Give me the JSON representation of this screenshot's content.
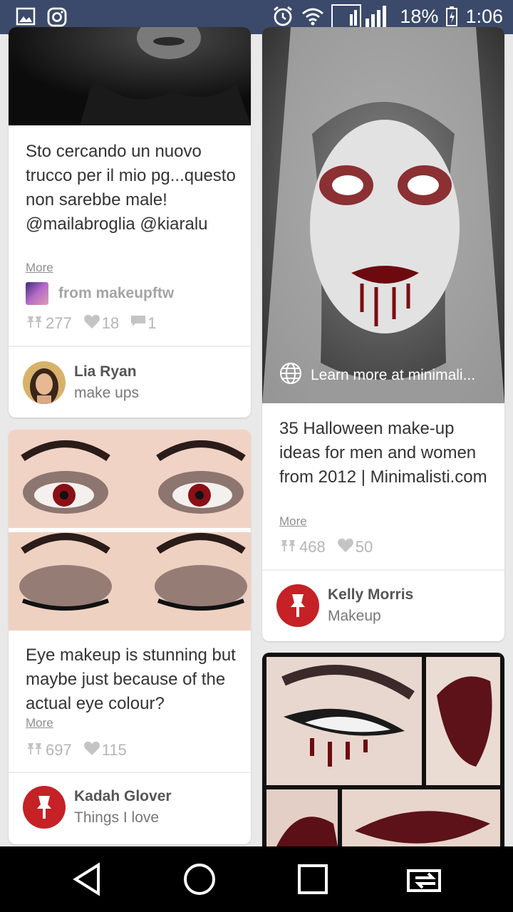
{
  "status_bar": {
    "battery": "18%",
    "time": "1:06",
    "icons": [
      "image-icon",
      "instagram-icon",
      "alarm-icon",
      "wifi-icon",
      "signal-icon",
      "battery-icon"
    ]
  },
  "pins": [
    {
      "description": "Sto cercando un nuovo trucco per il mio pg...questo non sarebbe male! @mailabroglia @kiaralu",
      "more": "More",
      "from": "from makeupftw",
      "repins": "277",
      "likes": "18",
      "comments": "1",
      "author": "Lia Ryan",
      "board": "make ups"
    },
    {
      "description": "Eye makeup is stunning but maybe just because of the actual eye colour?",
      "more": "More",
      "repins": "697",
      "likes": "115",
      "author": "Kadah Glover",
      "board": "Things I love"
    },
    {
      "learn_more": "Learn more at minimali...",
      "description": "35 Halloween make-up ideas for men and women from 2012 | Minimalisti.com",
      "more": "More",
      "repins": "468",
      "likes": "50",
      "author": "Kelly Morris",
      "board": "Makeup"
    }
  ],
  "colors": {
    "status_bar": "#3b4a6b",
    "pin_red": "#c52126",
    "background": "#e9e9e9"
  }
}
